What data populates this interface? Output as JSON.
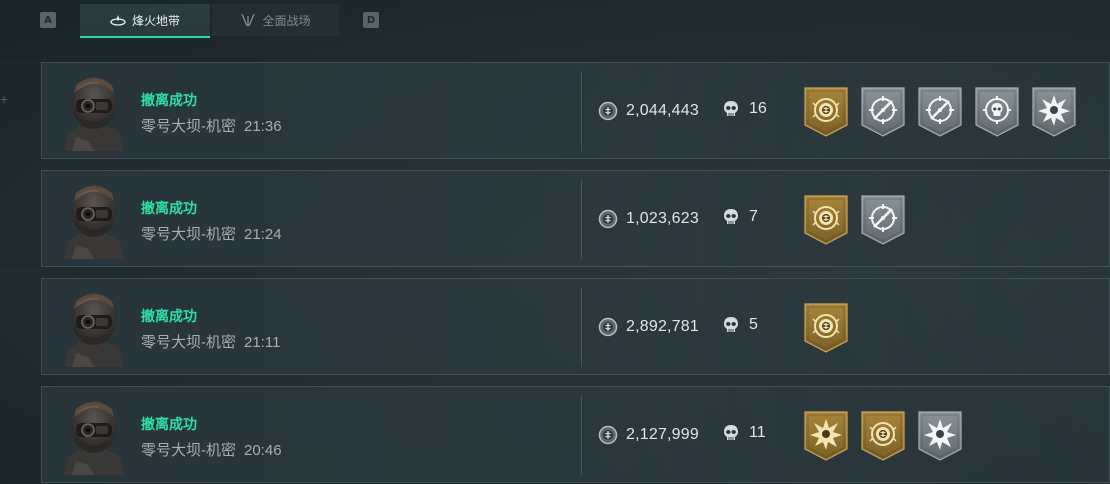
{
  "tabs": {
    "left_key": "A",
    "right_key": "D",
    "items": [
      {
        "label": "烽火地带",
        "active": true,
        "icon": "fire-zone-icon"
      },
      {
        "label": "全面战场",
        "active": false,
        "icon": "battlefield-icon"
      }
    ]
  },
  "colors": {
    "accent": "#2fe0a6",
    "gold_badge": "#b08b3a",
    "silver_badge": "#7d878b"
  },
  "records": [
    {
      "status": "撤离成功",
      "map": "零号大坝-机密",
      "time": "21:36",
      "value": "2,044,443",
      "kills": "16",
      "badges": [
        {
          "type": "gold",
          "icon": "emblem-coin-icon"
        },
        {
          "type": "silver",
          "icon": "crosshair-slash-icon"
        },
        {
          "type": "silver",
          "icon": "crosshair-slash-icon"
        },
        {
          "type": "silver",
          "icon": "skull-target-icon"
        },
        {
          "type": "silver",
          "icon": "burst-icon"
        }
      ]
    },
    {
      "status": "撤离成功",
      "map": "零号大坝-机密",
      "time": "21:24",
      "value": "1,023,623",
      "kills": "7",
      "badges": [
        {
          "type": "gold",
          "icon": "emblem-coin-icon"
        },
        {
          "type": "silver",
          "icon": "crosshair-slash-icon"
        }
      ]
    },
    {
      "status": "撤离成功",
      "map": "零号大坝-机密",
      "time": "21:11",
      "value": "2,892,781",
      "kills": "5",
      "badges": [
        {
          "type": "gold",
          "icon": "emblem-coin-icon"
        }
      ]
    },
    {
      "status": "撤离成功",
      "map": "零号大坝-机密",
      "time": "20:46",
      "value": "2,127,999",
      "kills": "11",
      "badges": [
        {
          "type": "gold",
          "icon": "burst-icon"
        },
        {
          "type": "gold",
          "icon": "emblem-coin-icon"
        },
        {
          "type": "silver",
          "icon": "burst-icon"
        }
      ]
    }
  ]
}
